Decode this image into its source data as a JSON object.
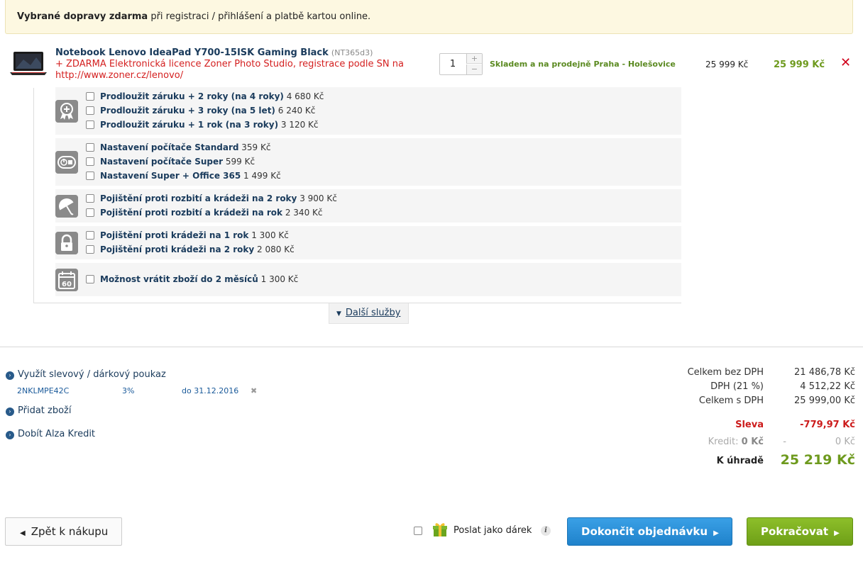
{
  "banner": {
    "bold": "Vybrané dopravy zdarma",
    "rest": " při registraci / přihlášení a platbě kartou online."
  },
  "product": {
    "name": "Notebook Lenovo IdeaPad Y700-15ISK Gaming Black",
    "code": "(NT365d3)",
    "extra": "+ ZDARMA Elektronická licence Zoner Photo Studio, registrace podle SN na http://www.zoner.cz/lenovo/",
    "quantity": "1",
    "plus": "+",
    "minus": "−",
    "stock": "Skladem a na prodejně Praha - Holešovice",
    "unit_price": "25 999 Kč",
    "total_price": "25 999 Kč",
    "remove_icon": "close-icon"
  },
  "services": [
    {
      "icon": "warranty-icon",
      "items": [
        {
          "label": "Prodloužit záruku + 2 roky (na 4 roky)",
          "price": "4 680 Kč"
        },
        {
          "label": "Prodloužit záruku + 3 roky (na 5 let)",
          "price": "6 240 Kč"
        },
        {
          "label": "Prodloužit záruku + 1 rok (na 3 roky)",
          "price": "3 120 Kč"
        }
      ]
    },
    {
      "icon": "power-setup-icon",
      "items": [
        {
          "label": "Nastavení počítače Standard",
          "price": "359 Kč"
        },
        {
          "label": "Nastavení počítače Super",
          "price": "599 Kč"
        },
        {
          "label": "Nastavení Super + Office 365",
          "price": "1 499 Kč"
        }
      ]
    },
    {
      "icon": "umbrella-icon",
      "items": [
        {
          "label": "Pojištění proti rozbití a krádeži na 2 roky",
          "price": "3 900 Kč"
        },
        {
          "label": "Pojištění proti rozbití a krádeži na rok",
          "price": "2 340 Kč"
        }
      ]
    },
    {
      "icon": "lock-icon",
      "items": [
        {
          "label": "Pojištění proti krádeži na 1 rok",
          "price": "1 300 Kč"
        },
        {
          "label": "Pojištění proti krádeži na 2 roky",
          "price": "2 080 Kč"
        }
      ]
    },
    {
      "icon": "calendar-60-icon",
      "badge": "60",
      "items": [
        {
          "label": "Možnost vrátit zboží do 2 měsíců",
          "price": "1 300 Kč"
        }
      ]
    }
  ],
  "more_services": "Další služby",
  "links": {
    "voucher": "Využít slevový / dárkový poukaz",
    "add_goods": "Přidat zboží",
    "credit": "Dobít Alza Kredit"
  },
  "voucher": {
    "code": "2NKLMPE42C",
    "percent": "3%",
    "valid": "do 31.12.2016",
    "remove": "✖"
  },
  "summary": {
    "without_vat_label": "Celkem bez DPH",
    "without_vat": "21 486,78 Kč",
    "vat_label": "DPH (21 %)",
    "vat": "4 512,22 Kč",
    "with_vat_label": "Celkem s DPH",
    "with_vat": "25 999,00 Kč",
    "discount_label": "Sleva",
    "discount": "-779,97 Kč",
    "credit_label": "Kredit:",
    "credit_amount": "0 Kč",
    "credit_dash": "-",
    "credit_value": "0 Kč",
    "total_label": "K úhradě",
    "total": "25 219 Kč"
  },
  "buttons": {
    "back": "Zpět k nákupu",
    "gift": "Poslat jako dárek",
    "info": "i",
    "finish": "Dokončit objednávku",
    "continue": "Pokračovat"
  },
  "colors": {
    "price_green": "#6e9a1e",
    "discount_red": "#cc1b1b",
    "link_blue": "#1a3b5c",
    "button_blue": "#1f82cb",
    "button_green": "#7aab1e"
  }
}
